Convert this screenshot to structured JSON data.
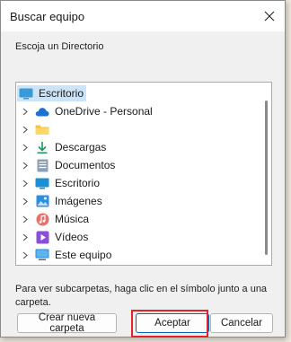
{
  "dialog": {
    "title": "Buscar equipo",
    "close_icon": "close-icon",
    "prompt": "Escoja un Directorio",
    "hint": "Para ver subcarpetas, haga clic en el símbolo junto a una carpeta."
  },
  "tree": {
    "root": {
      "label": "Escritorio",
      "icon": "desktop-icon",
      "selected": true
    },
    "items": [
      {
        "label": "OneDrive - Personal",
        "icon": "onedrive-cloud-icon"
      },
      {
        "label": "",
        "icon": "folder-icon"
      },
      {
        "label": "Descargas",
        "icon": "downloads-icon"
      },
      {
        "label": "Documentos",
        "icon": "documents-icon"
      },
      {
        "label": "Escritorio",
        "icon": "desktop-icon"
      },
      {
        "label": "Imágenes",
        "icon": "pictures-icon"
      },
      {
        "label": "Música",
        "icon": "music-icon"
      },
      {
        "label": "Vídeos",
        "icon": "videos-icon"
      },
      {
        "label": "Este equipo",
        "icon": "this-pc-icon"
      }
    ]
  },
  "buttons": {
    "new_folder": "Crear nueva carpeta",
    "ok": "Aceptar",
    "cancel": "Cancelar"
  },
  "colors": {
    "selection": "#cce4f7",
    "highlight_box": "#e8202a",
    "accent": "#0067c0"
  }
}
